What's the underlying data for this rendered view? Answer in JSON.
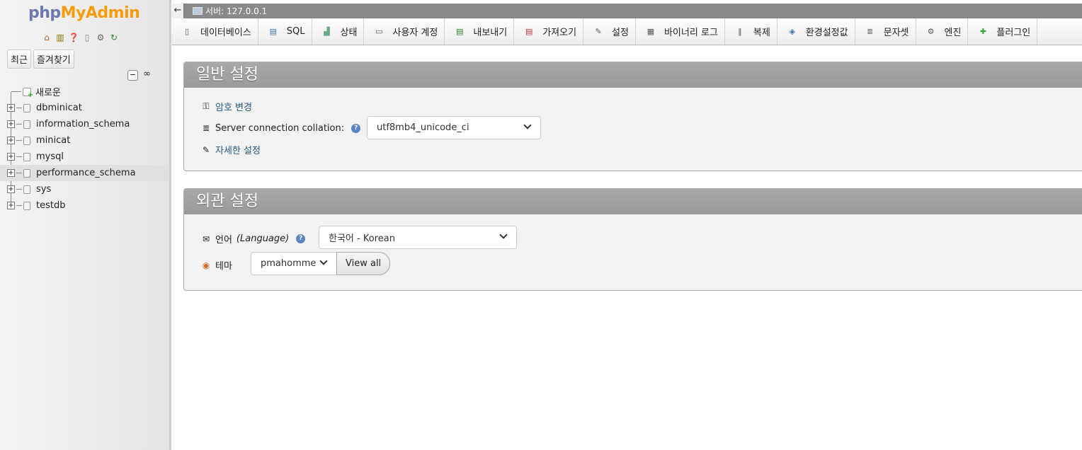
{
  "logo": {
    "part1": "php",
    "part2": "MyAdmin"
  },
  "nav": {
    "icons": [
      "home-icon",
      "database-icon",
      "help-icon",
      "document-icon",
      "settings-icon",
      "reload-icon"
    ],
    "recent_label": "최근",
    "favorites_label": "즐겨찾기",
    "collapse_label": "−",
    "link_label": "∞",
    "new_label": "새로운",
    "databases": [
      "dbminicat",
      "information_schema",
      "minicat",
      "mysql",
      "performance_schema",
      "sys",
      "testdb"
    ]
  },
  "topbar": {
    "back": "←",
    "server": "서버: 127.0.0.1"
  },
  "menu": [
    {
      "label": "데이터베이스",
      "icon": "database-icon"
    },
    {
      "label": "SQL",
      "icon": "sql-icon"
    },
    {
      "label": "상태",
      "icon": "status-icon"
    },
    {
      "label": "사용자 계정",
      "icon": "users-icon"
    },
    {
      "label": "내보내기",
      "icon": "export-icon"
    },
    {
      "label": "가져오기",
      "icon": "import-icon"
    },
    {
      "label": "설정",
      "icon": "wrench-icon"
    },
    {
      "label": "바이너리 로그",
      "icon": "binlog-icon"
    },
    {
      "label": "복제",
      "icon": "replication-icon"
    },
    {
      "label": "환경설정값",
      "icon": "variables-icon"
    },
    {
      "label": "문자셋",
      "icon": "charset-icon"
    },
    {
      "label": "엔진",
      "icon": "engine-icon"
    },
    {
      "label": "플러그인",
      "icon": "plugin-icon"
    }
  ],
  "general": {
    "title": "일반 설정",
    "change_password": "암호 변경",
    "collation_label": "Server connection collation:",
    "collation_value": "utf8mb4_unicode_ci",
    "more_settings": "자세한 설정"
  },
  "appearance": {
    "title": "외관 설정",
    "language_label": "언어",
    "language_italic": "(Language)",
    "language_value": "한국어 - Korean",
    "theme_label": "테마",
    "theme_value": "pmahomme",
    "view_all": "View all"
  },
  "colors": {
    "accent": "#235a81",
    "logo_php": "#6c78af",
    "logo_admin": "#f89c0e",
    "panel_header": "#9e9e9e"
  }
}
